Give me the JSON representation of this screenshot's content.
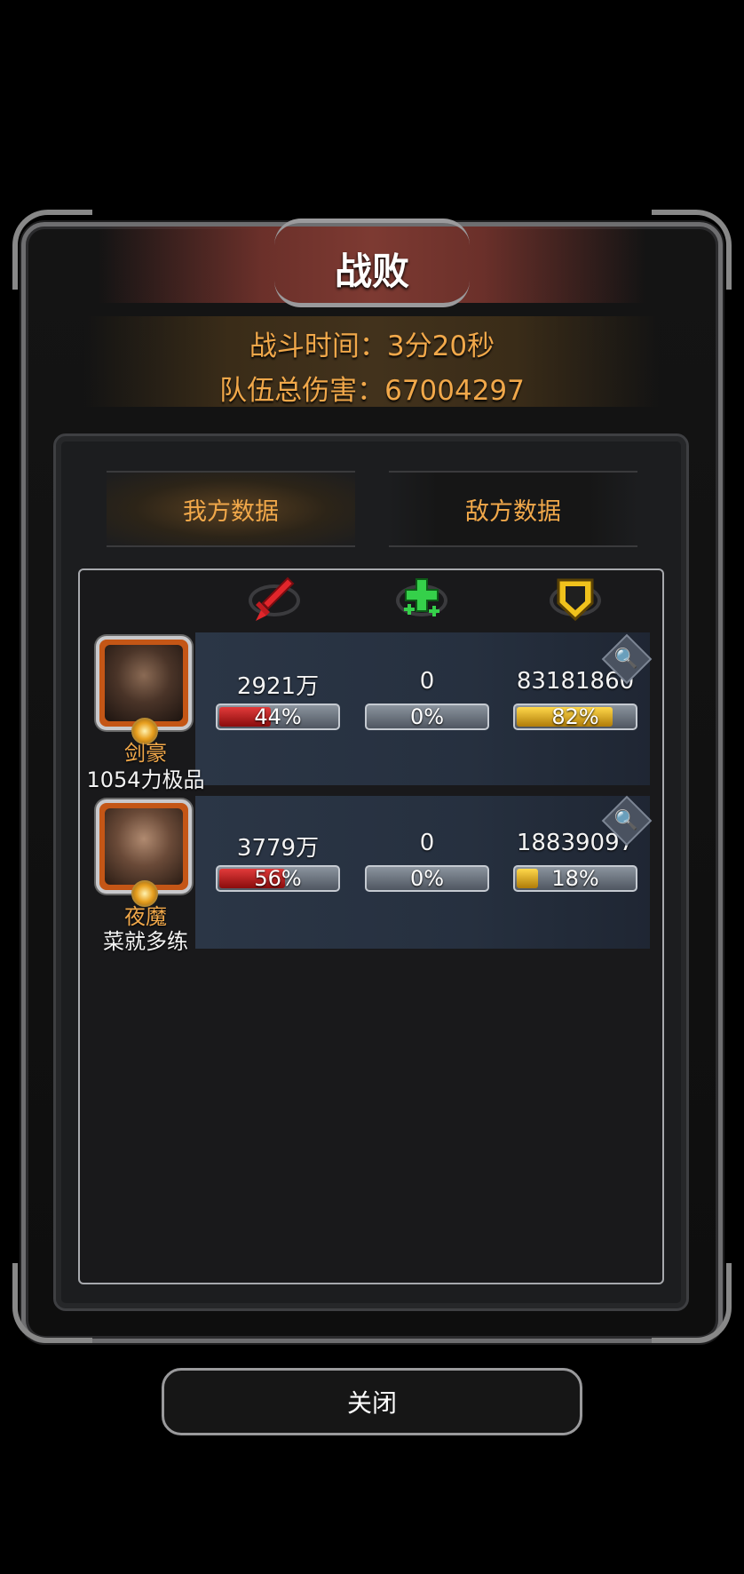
{
  "dialog": {
    "title": "战败",
    "battle_time": "战斗时间：3分20秒",
    "total_damage": "队伍总伤害：67004297"
  },
  "tabs": [
    {
      "label": "我方数据",
      "active": true
    },
    {
      "label": "敌方数据",
      "active": false
    }
  ],
  "stat_columns": [
    {
      "icon": "sword-icon",
      "color": "#e1262b"
    },
    {
      "icon": "heal-cross-icon",
      "color": "#35d04a"
    },
    {
      "icon": "shield-icon",
      "color": "#f0c21c"
    }
  ],
  "players": [
    {
      "hero": "剑豪",
      "player": "1054力极品",
      "damage": "2921万",
      "damage_pct": "44%",
      "damage_fraction": 0.44,
      "heal": "0",
      "heal_pct": "0%",
      "heal_fraction": 0,
      "tank": "83181860",
      "tank_pct": "82%",
      "tank_fraction": 0.82
    },
    {
      "hero": "夜魔",
      "player": "菜就多练",
      "damage": "3779万",
      "damage_pct": "56%",
      "damage_fraction": 0.56,
      "heal": "0",
      "heal_pct": "0%",
      "heal_fraction": 0,
      "tank": "18839097",
      "tank_pct": "18%",
      "tank_fraction": 0.18
    }
  ],
  "close_label": "关闭",
  "colors": {
    "accent_orange": "#f1a84a",
    "banner_red": "#7d3a32",
    "bar_red": "#e23a3a",
    "bar_gold": "#ffd84a"
  }
}
